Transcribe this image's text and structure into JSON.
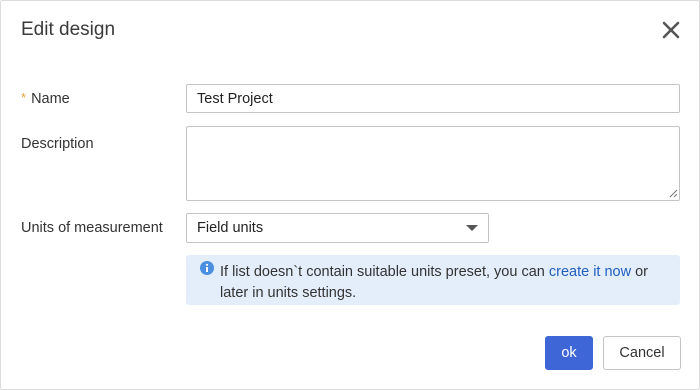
{
  "dialog": {
    "title": "Edit design"
  },
  "form": {
    "name": {
      "required_mark": "*",
      "label": "Name",
      "value": "Test Project"
    },
    "description": {
      "label": "Description",
      "value": ""
    },
    "units": {
      "label": "Units of measurement",
      "selected": "Field units"
    }
  },
  "info": {
    "text_before": "If list doesn`t contain suitable units preset, you can",
    "link": "create it now",
    "text_after": "or later in units settings."
  },
  "buttons": {
    "ok": "ok",
    "cancel": "Cancel"
  },
  "colors": {
    "primary": "#3f66d6",
    "link": "#1f5fbf",
    "info_bg": "#e4eefb",
    "info_icon": "#4a8fe0",
    "required_star": "#e0a13a"
  },
  "icons": {
    "close": "close-icon",
    "info": "info-icon",
    "dropdown": "chevron-down-icon"
  }
}
